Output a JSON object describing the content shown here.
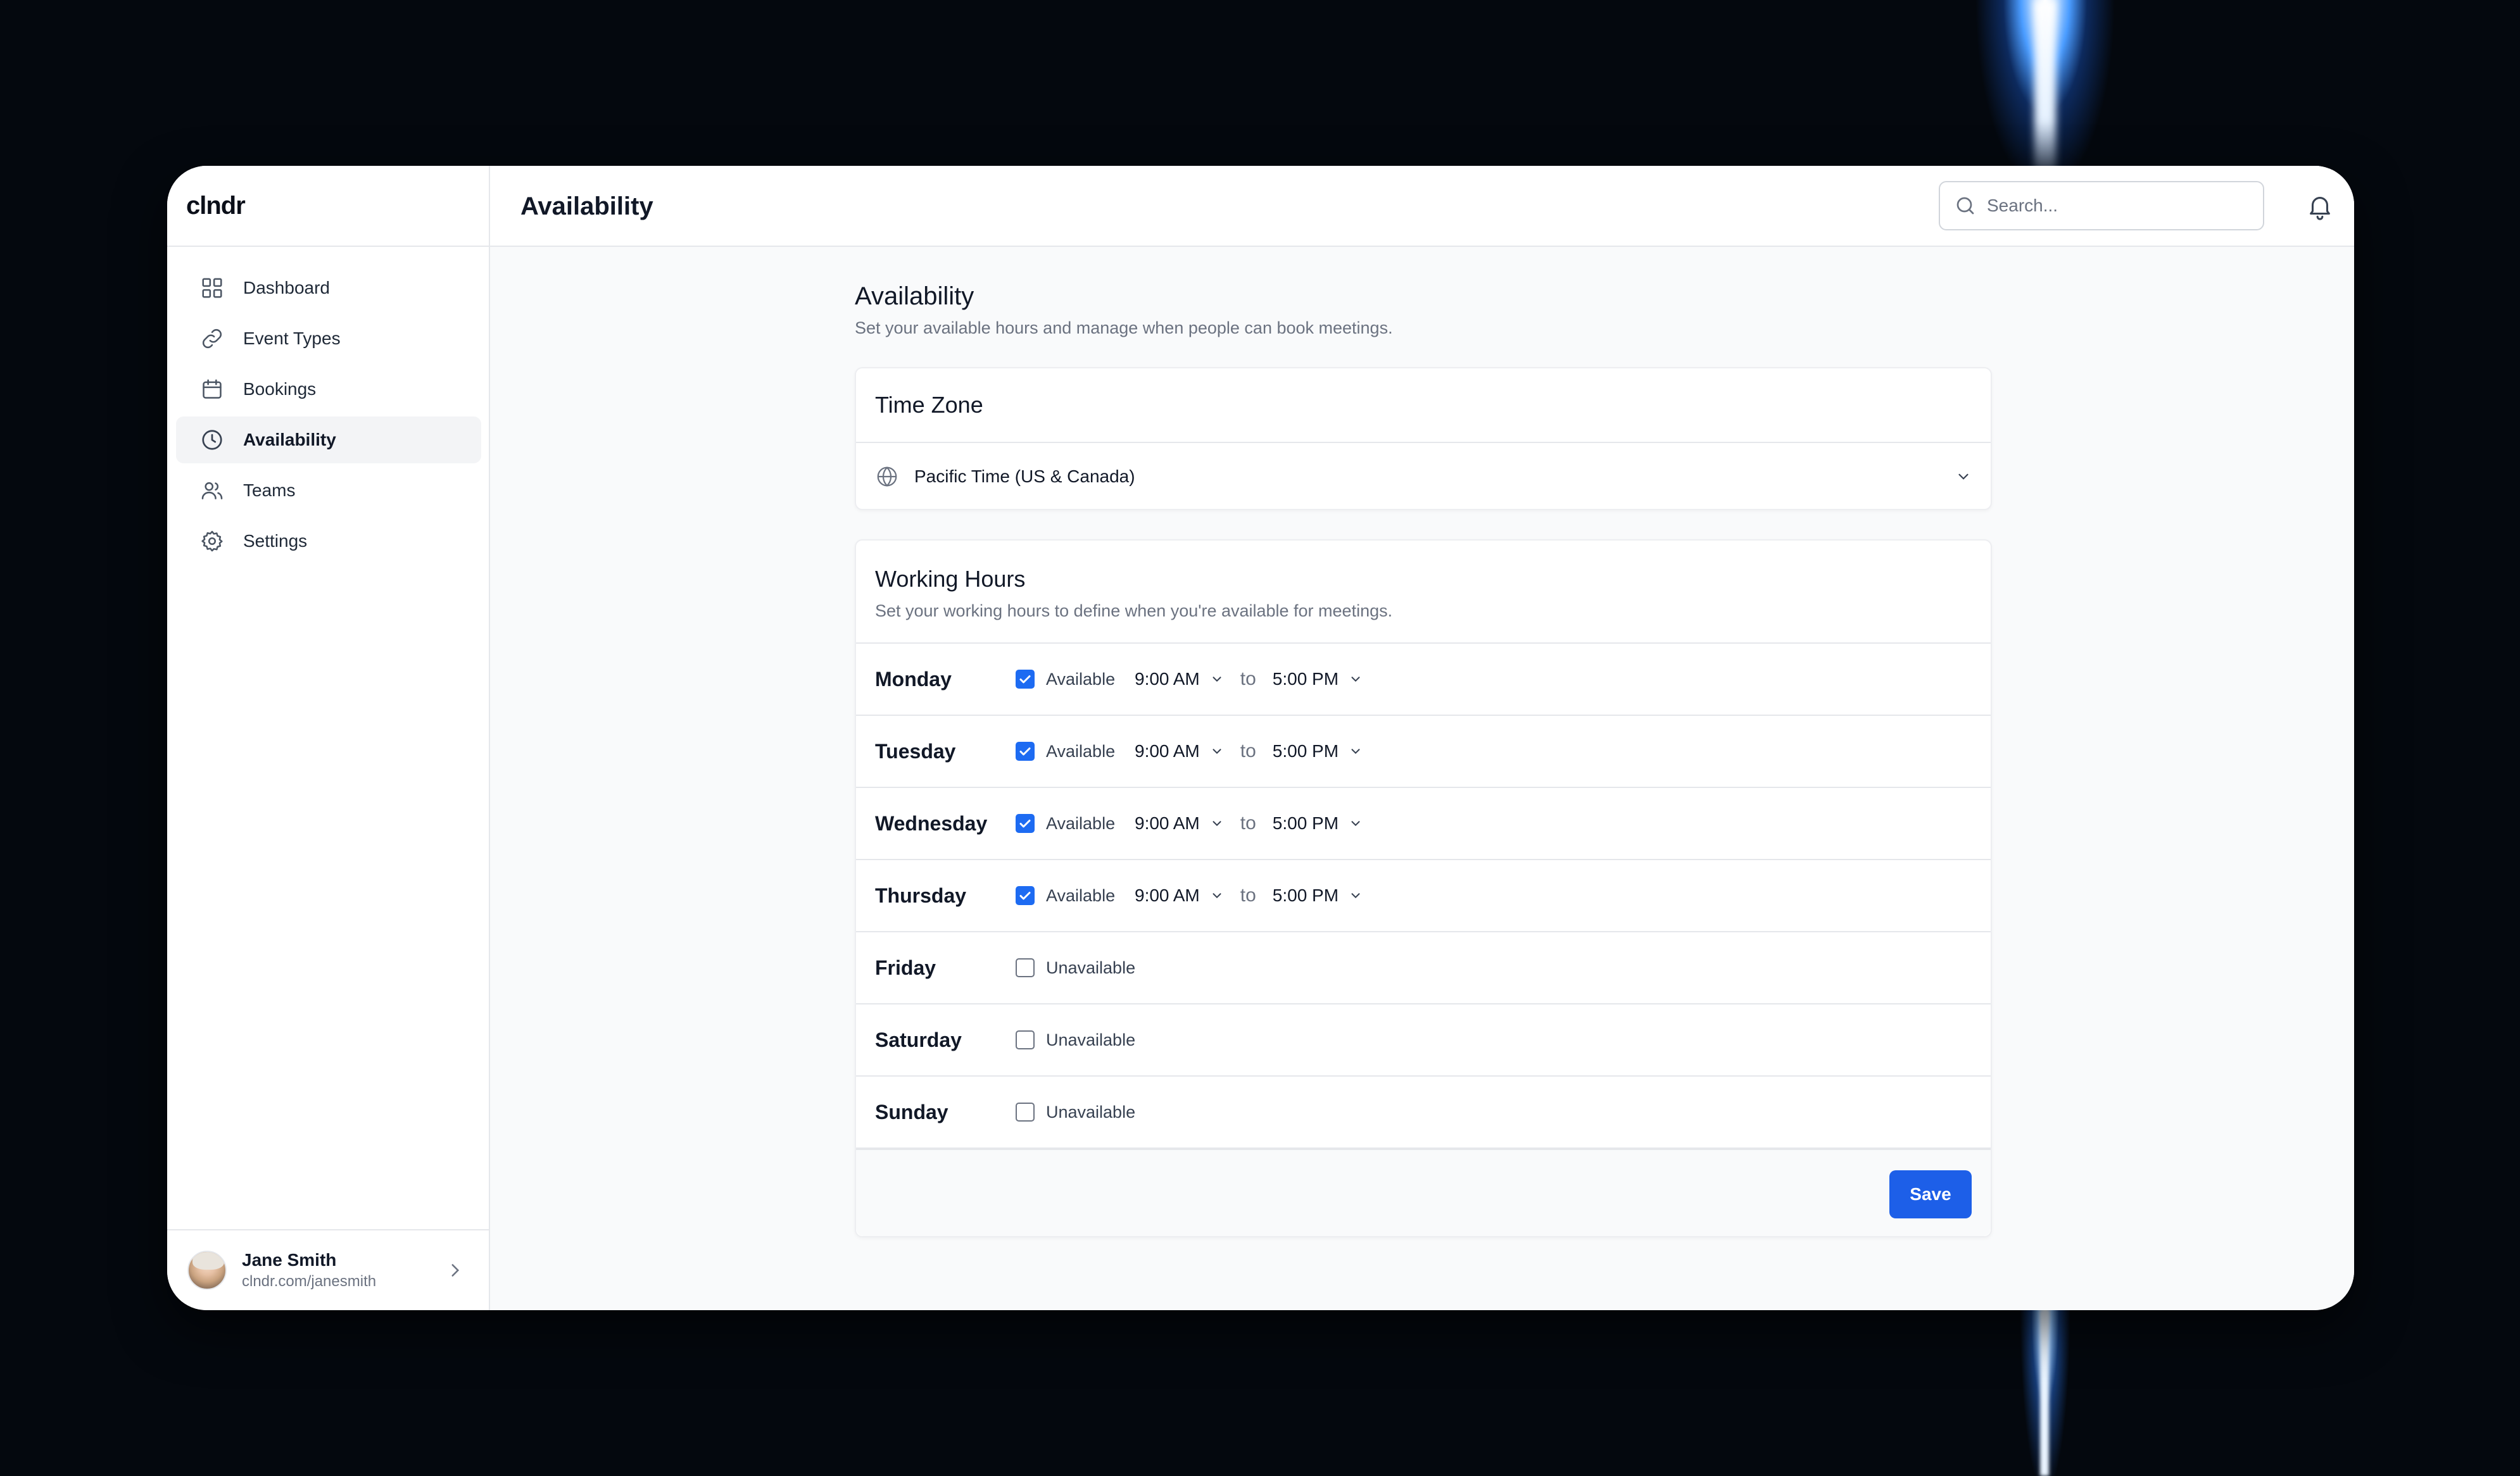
{
  "app": {
    "logo": "clndr"
  },
  "sidebar": {
    "items": [
      {
        "label": "Dashboard",
        "icon": "grid-icon",
        "active": false
      },
      {
        "label": "Event Types",
        "icon": "link-icon",
        "active": false
      },
      {
        "label": "Bookings",
        "icon": "calendar-icon",
        "active": false
      },
      {
        "label": "Availability",
        "icon": "clock-icon",
        "active": true
      },
      {
        "label": "Teams",
        "icon": "users-icon",
        "active": false
      },
      {
        "label": "Settings",
        "icon": "gear-icon",
        "active": false
      }
    ],
    "user": {
      "name": "Jane Smith",
      "url": "clndr.com/janesmith"
    }
  },
  "header": {
    "title": "Availability",
    "search_placeholder": "Search..."
  },
  "page": {
    "heading": "Availability",
    "subheading": "Set your available hours and manage when people can book meetings."
  },
  "timezone": {
    "title": "Time Zone",
    "value": "Pacific Time (US & Canada)"
  },
  "working_hours": {
    "title": "Working Hours",
    "subtitle": "Set your working hours to define when you're available for meetings.",
    "to_label": "to",
    "days": [
      {
        "day": "Monday",
        "available": true,
        "status": "Available",
        "start": "9:00 AM",
        "end": "5:00 PM"
      },
      {
        "day": "Tuesday",
        "available": true,
        "status": "Available",
        "start": "9:00 AM",
        "end": "5:00 PM"
      },
      {
        "day": "Wednesday",
        "available": true,
        "status": "Available",
        "start": "9:00 AM",
        "end": "5:00 PM"
      },
      {
        "day": "Thursday",
        "available": true,
        "status": "Available",
        "start": "9:00 AM",
        "end": "5:00 PM"
      },
      {
        "day": "Friday",
        "available": false,
        "status": "Unavailable"
      },
      {
        "day": "Saturday",
        "available": false,
        "status": "Unavailable"
      },
      {
        "day": "Sunday",
        "available": false,
        "status": "Unavailable"
      }
    ],
    "save_label": "Save"
  },
  "colors": {
    "accent": "#1d5fe8",
    "checkbox": "#1d6bf2",
    "background": "#04080e"
  }
}
